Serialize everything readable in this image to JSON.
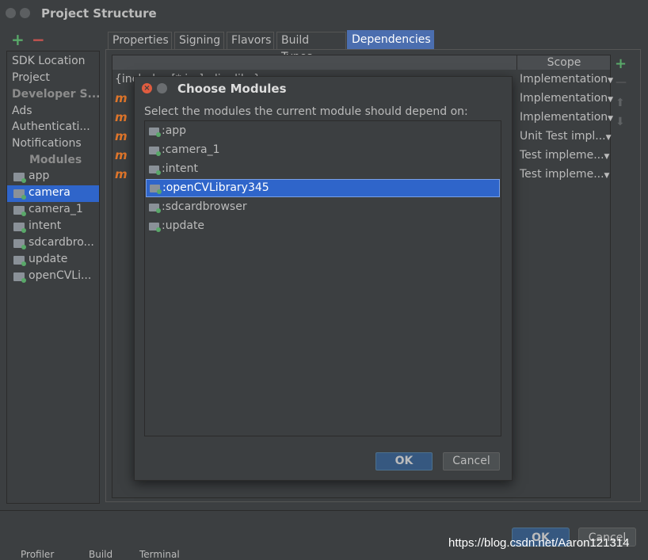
{
  "window": {
    "title": "Project Structure"
  },
  "sidebar": {
    "settings_items": [
      "SDK Location",
      "Project",
      "Developer S...",
      "Ads",
      "Authenticati...",
      "Notifications"
    ],
    "modules_heading": "Modules",
    "modules": [
      {
        "label": "app",
        "selected": false
      },
      {
        "label": "camera",
        "selected": true
      },
      {
        "label": "camera_1",
        "selected": false
      },
      {
        "label": "intent",
        "selected": false
      },
      {
        "label": "sdcardbro...",
        "selected": false
      },
      {
        "label": "update",
        "selected": false
      },
      {
        "label": "openCVLi...",
        "selected": false
      }
    ]
  },
  "tabs": [
    {
      "label": "Properties",
      "active": false
    },
    {
      "label": "Signing",
      "active": false
    },
    {
      "label": "Flavors",
      "active": false
    },
    {
      "label": "Build Types",
      "active": false
    },
    {
      "label": "Dependencies",
      "active": true
    }
  ],
  "dependencies": {
    "scope_header": "Scope",
    "first_row": "{include=[*.jar], dir=libs}",
    "module_marker": "m",
    "scopes": [
      "Implementation",
      "Implementation",
      "Implementation",
      "Unit Test impl...",
      "Test impleme...",
      "Test impleme..."
    ]
  },
  "dialog": {
    "title": "Choose Modules",
    "prompt": "Select the modules the current module should depend on:",
    "modules": [
      {
        "label": ":app",
        "selected": false
      },
      {
        "label": ":camera_1",
        "selected": false
      },
      {
        "label": ":intent",
        "selected": false
      },
      {
        "label": ":openCVLibrary345",
        "selected": true
      },
      {
        "label": ":sdcardbrowser",
        "selected": false
      },
      {
        "label": ":update",
        "selected": false
      }
    ],
    "ok_label": "OK",
    "cancel_label": "Cancel"
  },
  "footer": {
    "ok_label": "OK",
    "cancel_label": "Cancel",
    "status_items": [
      "Profiler",
      "Build",
      "Terminal"
    ],
    "watermark": "https://blog.csdn.net/Aaron121314"
  },
  "colors": {
    "selection": "#2f65ca",
    "accent_add": "#59a869",
    "accent_remove": "#c75450",
    "module_marker": "#e0762b"
  }
}
